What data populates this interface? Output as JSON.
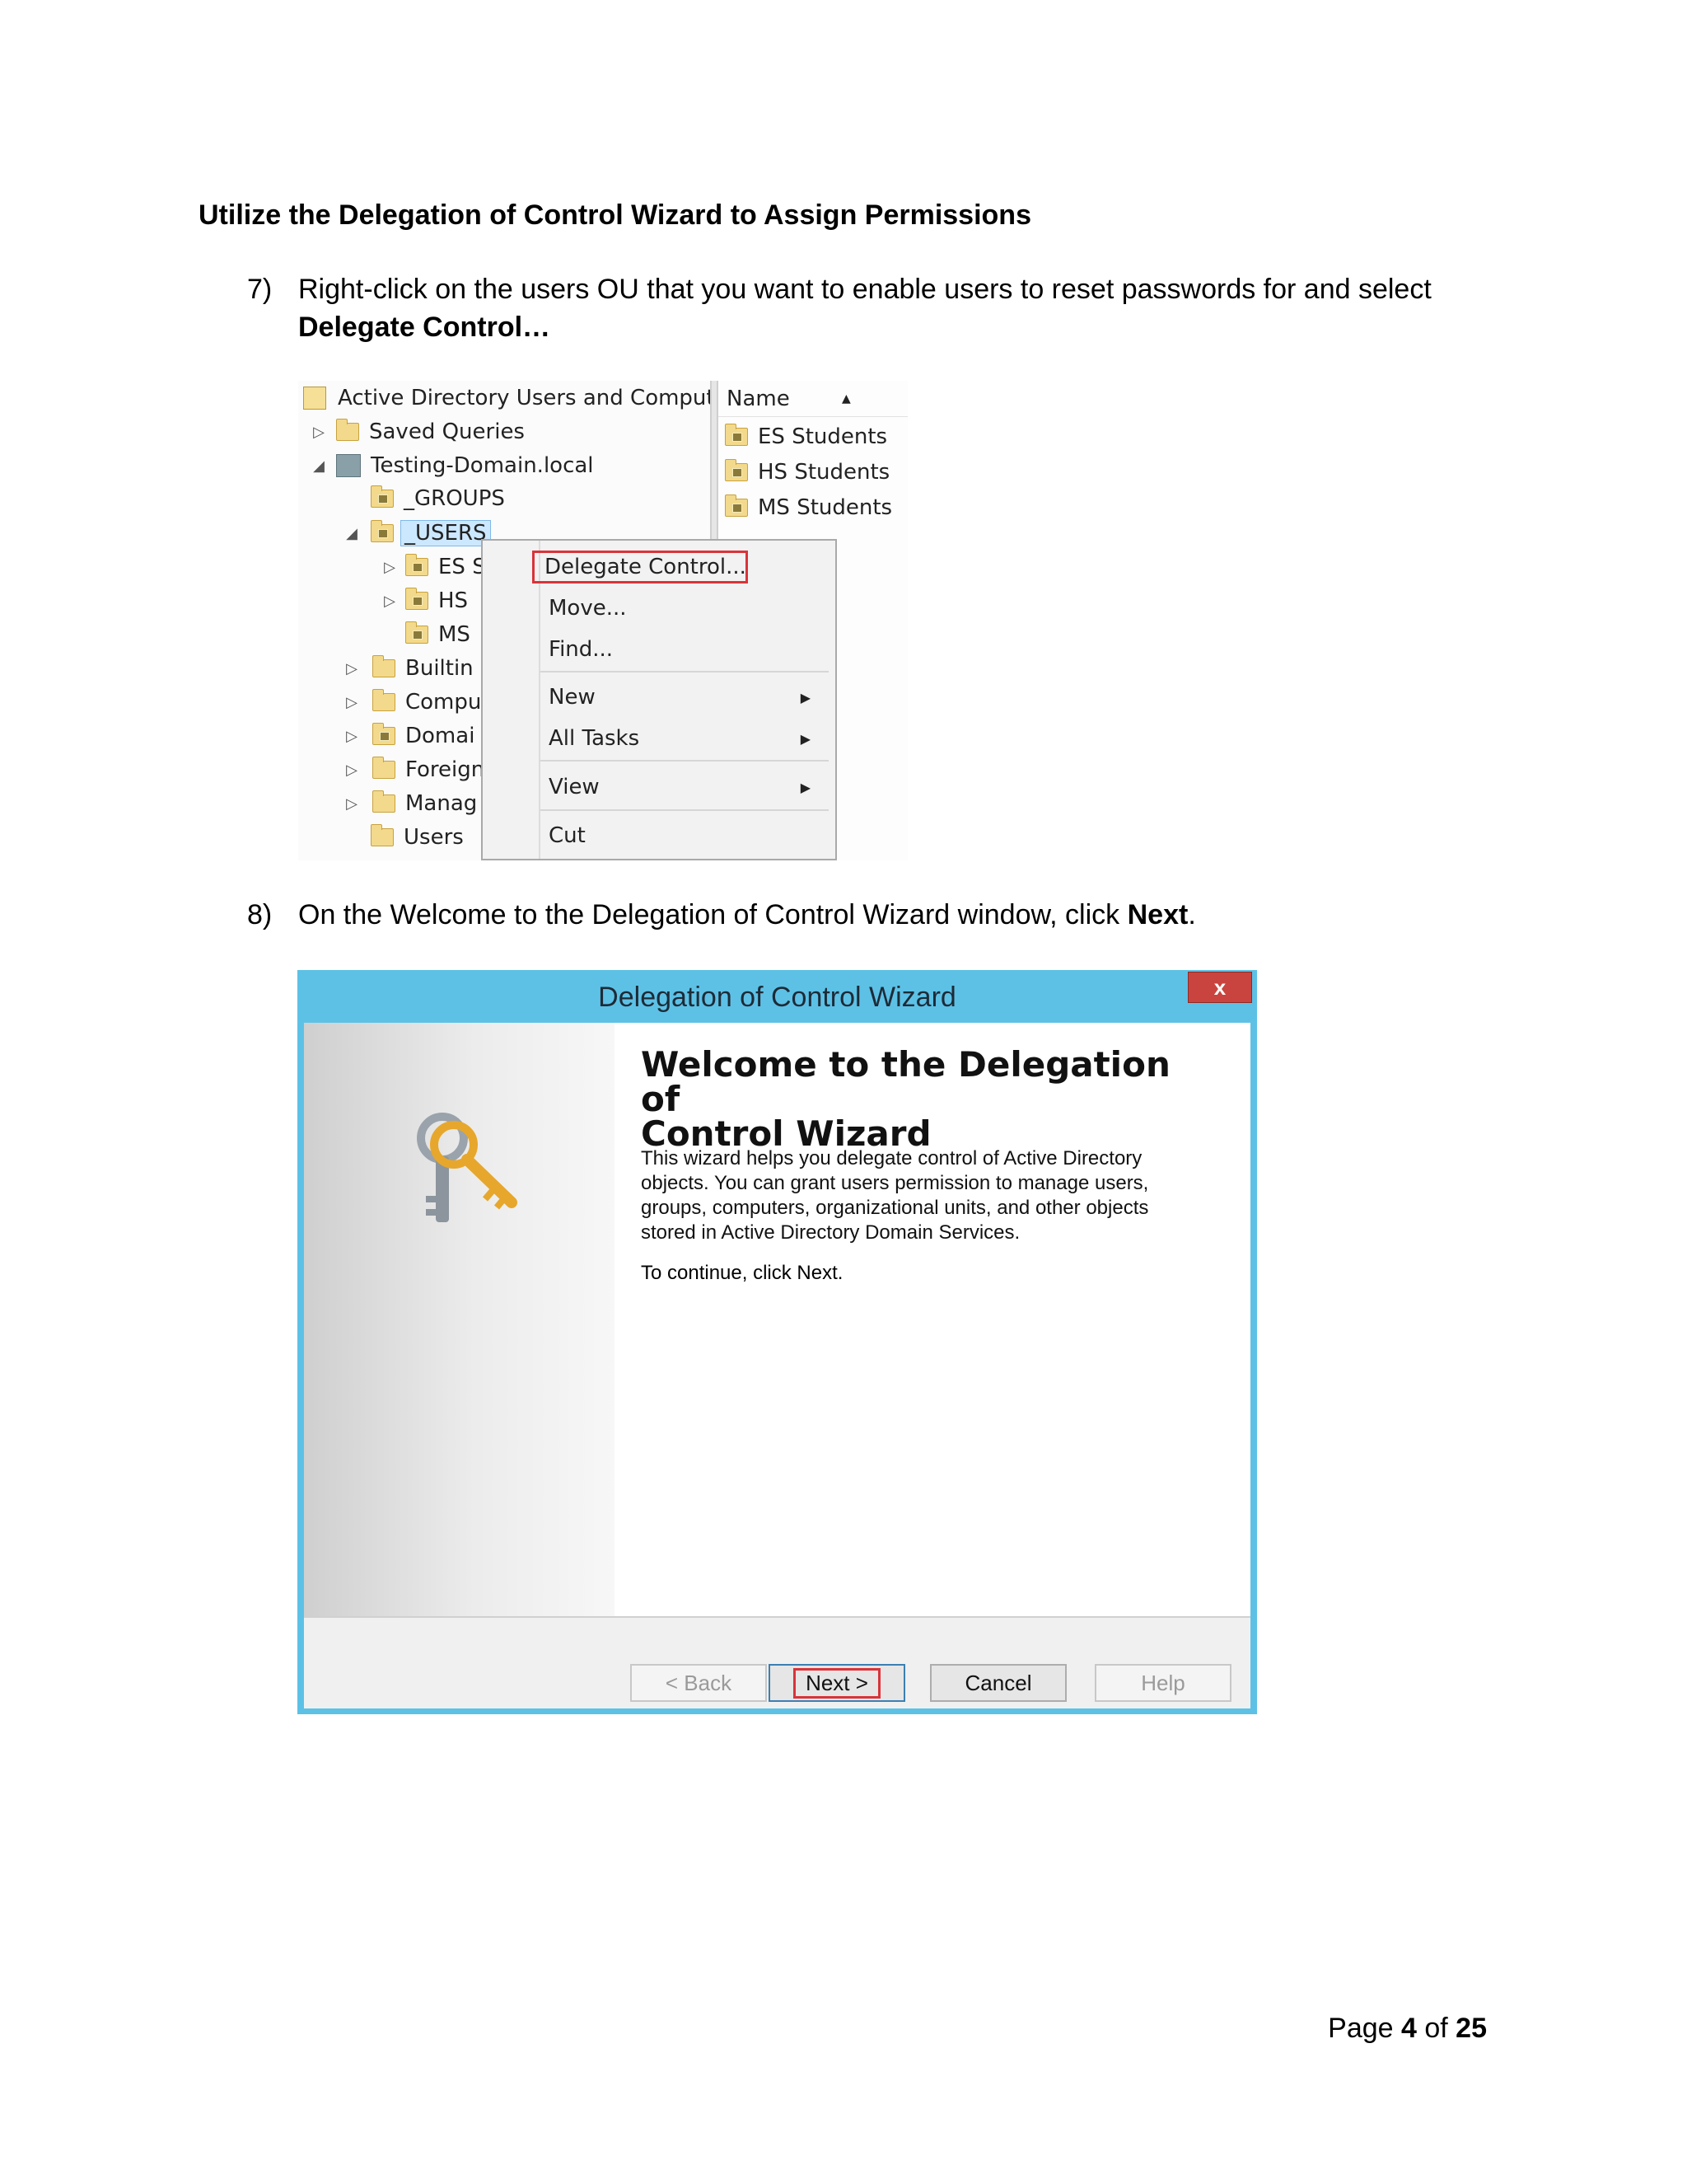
{
  "heading": "Utilize the Delegation of Control Wizard to Assign Permissions",
  "step7": {
    "number": "7)",
    "text": "Right-click on the users OU that you want to enable users to reset passwords for and select",
    "bold": "Delegate Control…"
  },
  "step8": {
    "number": "8)",
    "text_before": "On the Welcome to the Delegation of Control Wizard window, click ",
    "bold": "Next",
    "text_after": "."
  },
  "aduc": {
    "root": "Active Directory Users and Computer",
    "saved_queries": "Saved Queries",
    "domain": "Testing-Domain.local",
    "groups": "_GROUPS",
    "users": "_USERS",
    "child_es": "ES S",
    "child_hs": "HS",
    "child_ms": "MS",
    "builtin": "Builtin",
    "computers": "Compu",
    "domain_ctrl": "Domai",
    "foreign": "Foreign",
    "managed": "Manag",
    "users_folder": "Users",
    "list_header": "Name",
    "list_items": [
      "ES Students",
      "HS Students",
      "MS Students"
    ],
    "menu": {
      "delegate": "Delegate Control...",
      "move": "Move...",
      "find": "Find...",
      "new": "New",
      "all_tasks": "All Tasks",
      "view": "View",
      "cut": "Cut"
    }
  },
  "wizard": {
    "title": "Delegation of Control Wizard",
    "close": "x",
    "welcome_line1": "Welcome to the Delegation of",
    "welcome_line2": "Control Wizard",
    "description": "This wizard helps you delegate control of Active Directory objects. You can grant users permission to manage users, groups, computers, organizational units, and other objects stored in Active Directory Domain Services.",
    "continue": "To continue, click Next.",
    "buttons": {
      "back": "< Back",
      "next": "Next >",
      "cancel": "Cancel",
      "help": "Help"
    }
  },
  "page_footer": {
    "prefix": "Page ",
    "current": "4",
    "middle": " of ",
    "total": "25"
  }
}
